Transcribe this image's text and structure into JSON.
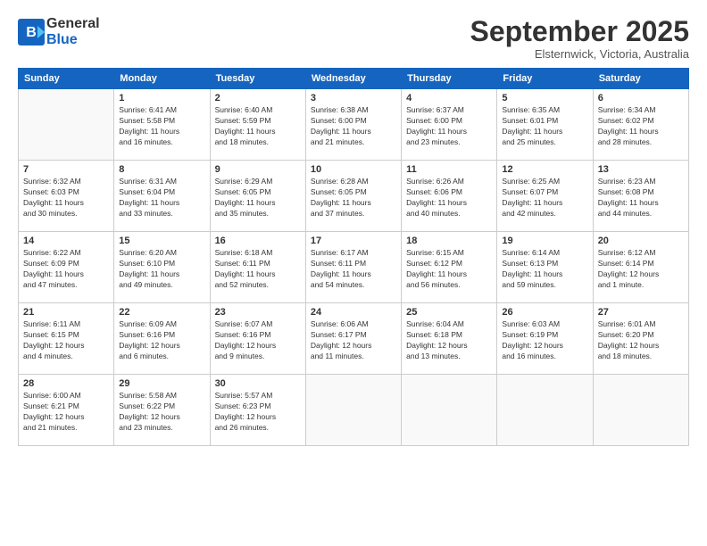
{
  "header": {
    "logo_line1": "General",
    "logo_line2": "Blue",
    "month": "September 2025",
    "location": "Elsternwick, Victoria, Australia"
  },
  "weekdays": [
    "Sunday",
    "Monday",
    "Tuesday",
    "Wednesday",
    "Thursday",
    "Friday",
    "Saturday"
  ],
  "weeks": [
    [
      {
        "day": "",
        "info": ""
      },
      {
        "day": "1",
        "info": "Sunrise: 6:41 AM\nSunset: 5:58 PM\nDaylight: 11 hours\nand 16 minutes."
      },
      {
        "day": "2",
        "info": "Sunrise: 6:40 AM\nSunset: 5:59 PM\nDaylight: 11 hours\nand 18 minutes."
      },
      {
        "day": "3",
        "info": "Sunrise: 6:38 AM\nSunset: 6:00 PM\nDaylight: 11 hours\nand 21 minutes."
      },
      {
        "day": "4",
        "info": "Sunrise: 6:37 AM\nSunset: 6:00 PM\nDaylight: 11 hours\nand 23 minutes."
      },
      {
        "day": "5",
        "info": "Sunrise: 6:35 AM\nSunset: 6:01 PM\nDaylight: 11 hours\nand 25 minutes."
      },
      {
        "day": "6",
        "info": "Sunrise: 6:34 AM\nSunset: 6:02 PM\nDaylight: 11 hours\nand 28 minutes."
      }
    ],
    [
      {
        "day": "7",
        "info": "Sunrise: 6:32 AM\nSunset: 6:03 PM\nDaylight: 11 hours\nand 30 minutes."
      },
      {
        "day": "8",
        "info": "Sunrise: 6:31 AM\nSunset: 6:04 PM\nDaylight: 11 hours\nand 33 minutes."
      },
      {
        "day": "9",
        "info": "Sunrise: 6:29 AM\nSunset: 6:05 PM\nDaylight: 11 hours\nand 35 minutes."
      },
      {
        "day": "10",
        "info": "Sunrise: 6:28 AM\nSunset: 6:05 PM\nDaylight: 11 hours\nand 37 minutes."
      },
      {
        "day": "11",
        "info": "Sunrise: 6:26 AM\nSunset: 6:06 PM\nDaylight: 11 hours\nand 40 minutes."
      },
      {
        "day": "12",
        "info": "Sunrise: 6:25 AM\nSunset: 6:07 PM\nDaylight: 11 hours\nand 42 minutes."
      },
      {
        "day": "13",
        "info": "Sunrise: 6:23 AM\nSunset: 6:08 PM\nDaylight: 11 hours\nand 44 minutes."
      }
    ],
    [
      {
        "day": "14",
        "info": "Sunrise: 6:22 AM\nSunset: 6:09 PM\nDaylight: 11 hours\nand 47 minutes."
      },
      {
        "day": "15",
        "info": "Sunrise: 6:20 AM\nSunset: 6:10 PM\nDaylight: 11 hours\nand 49 minutes."
      },
      {
        "day": "16",
        "info": "Sunrise: 6:18 AM\nSunset: 6:11 PM\nDaylight: 11 hours\nand 52 minutes."
      },
      {
        "day": "17",
        "info": "Sunrise: 6:17 AM\nSunset: 6:11 PM\nDaylight: 11 hours\nand 54 minutes."
      },
      {
        "day": "18",
        "info": "Sunrise: 6:15 AM\nSunset: 6:12 PM\nDaylight: 11 hours\nand 56 minutes."
      },
      {
        "day": "19",
        "info": "Sunrise: 6:14 AM\nSunset: 6:13 PM\nDaylight: 11 hours\nand 59 minutes."
      },
      {
        "day": "20",
        "info": "Sunrise: 6:12 AM\nSunset: 6:14 PM\nDaylight: 12 hours\nand 1 minute."
      }
    ],
    [
      {
        "day": "21",
        "info": "Sunrise: 6:11 AM\nSunset: 6:15 PM\nDaylight: 12 hours\nand 4 minutes."
      },
      {
        "day": "22",
        "info": "Sunrise: 6:09 AM\nSunset: 6:16 PM\nDaylight: 12 hours\nand 6 minutes."
      },
      {
        "day": "23",
        "info": "Sunrise: 6:07 AM\nSunset: 6:16 PM\nDaylight: 12 hours\nand 9 minutes."
      },
      {
        "day": "24",
        "info": "Sunrise: 6:06 AM\nSunset: 6:17 PM\nDaylight: 12 hours\nand 11 minutes."
      },
      {
        "day": "25",
        "info": "Sunrise: 6:04 AM\nSunset: 6:18 PM\nDaylight: 12 hours\nand 13 minutes."
      },
      {
        "day": "26",
        "info": "Sunrise: 6:03 AM\nSunset: 6:19 PM\nDaylight: 12 hours\nand 16 minutes."
      },
      {
        "day": "27",
        "info": "Sunrise: 6:01 AM\nSunset: 6:20 PM\nDaylight: 12 hours\nand 18 minutes."
      }
    ],
    [
      {
        "day": "28",
        "info": "Sunrise: 6:00 AM\nSunset: 6:21 PM\nDaylight: 12 hours\nand 21 minutes."
      },
      {
        "day": "29",
        "info": "Sunrise: 5:58 AM\nSunset: 6:22 PM\nDaylight: 12 hours\nand 23 minutes."
      },
      {
        "day": "30",
        "info": "Sunrise: 5:57 AM\nSunset: 6:23 PM\nDaylight: 12 hours\nand 26 minutes."
      },
      {
        "day": "",
        "info": ""
      },
      {
        "day": "",
        "info": ""
      },
      {
        "day": "",
        "info": ""
      },
      {
        "day": "",
        "info": ""
      }
    ]
  ]
}
